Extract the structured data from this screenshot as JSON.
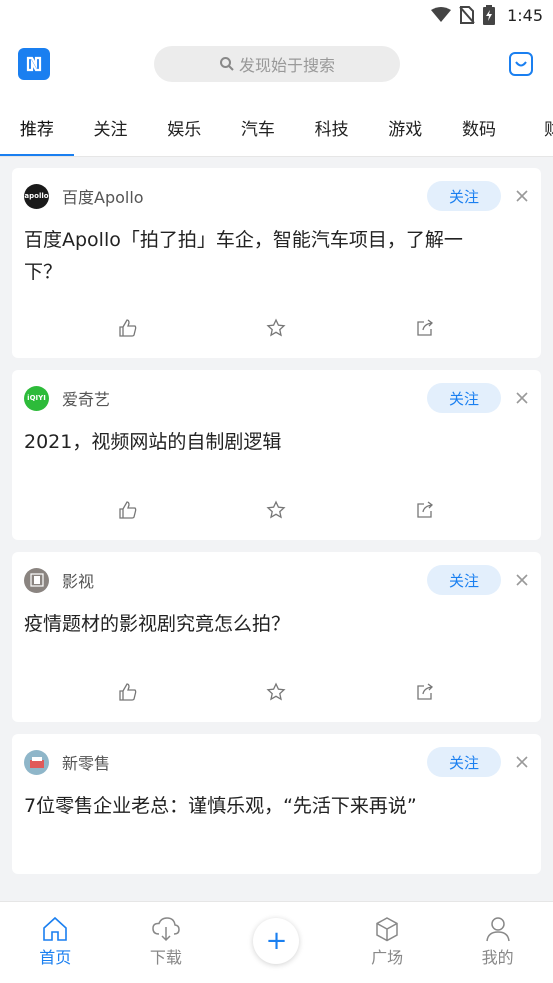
{
  "status": {
    "time": "1:45"
  },
  "header": {
    "search_placeholder": "发现始于搜索"
  },
  "tabs": [
    {
      "label": "推荐"
    },
    {
      "label": "关注"
    },
    {
      "label": "娱乐"
    },
    {
      "label": "汽车"
    },
    {
      "label": "科技"
    },
    {
      "label": "游戏"
    },
    {
      "label": "数码"
    },
    {
      "label": "财"
    }
  ],
  "feed": [
    {
      "source": "百度Apollo",
      "follow": "关注",
      "title": "百度Apollo「拍了拍」车企，智能汽车项目，了解一下？",
      "avatar_text": "apollo",
      "avatar_color": "#1a1a1a"
    },
    {
      "source": "爱奇艺",
      "follow": "关注",
      "title": "2021，视频网站的自制剧逻辑",
      "avatar_text": "iQIYI",
      "avatar_color": "#2dbb3a"
    },
    {
      "source": "影视",
      "follow": "关注",
      "title": "疫情题材的影视剧究竟怎么拍？",
      "avatar_text": "",
      "avatar_color": "#8a8480"
    },
    {
      "source": "新零售",
      "follow": "关注",
      "title": "7位零售企业老总：谨慎乐观，“先活下来再说”",
      "avatar_text": "",
      "avatar_color": "#8fb6c9"
    }
  ],
  "bottom_nav": {
    "home": "首页",
    "download": "下载",
    "plus": "+",
    "square": "广场",
    "mine": "我的"
  },
  "colors": {
    "accent": "#1a7ff0"
  }
}
